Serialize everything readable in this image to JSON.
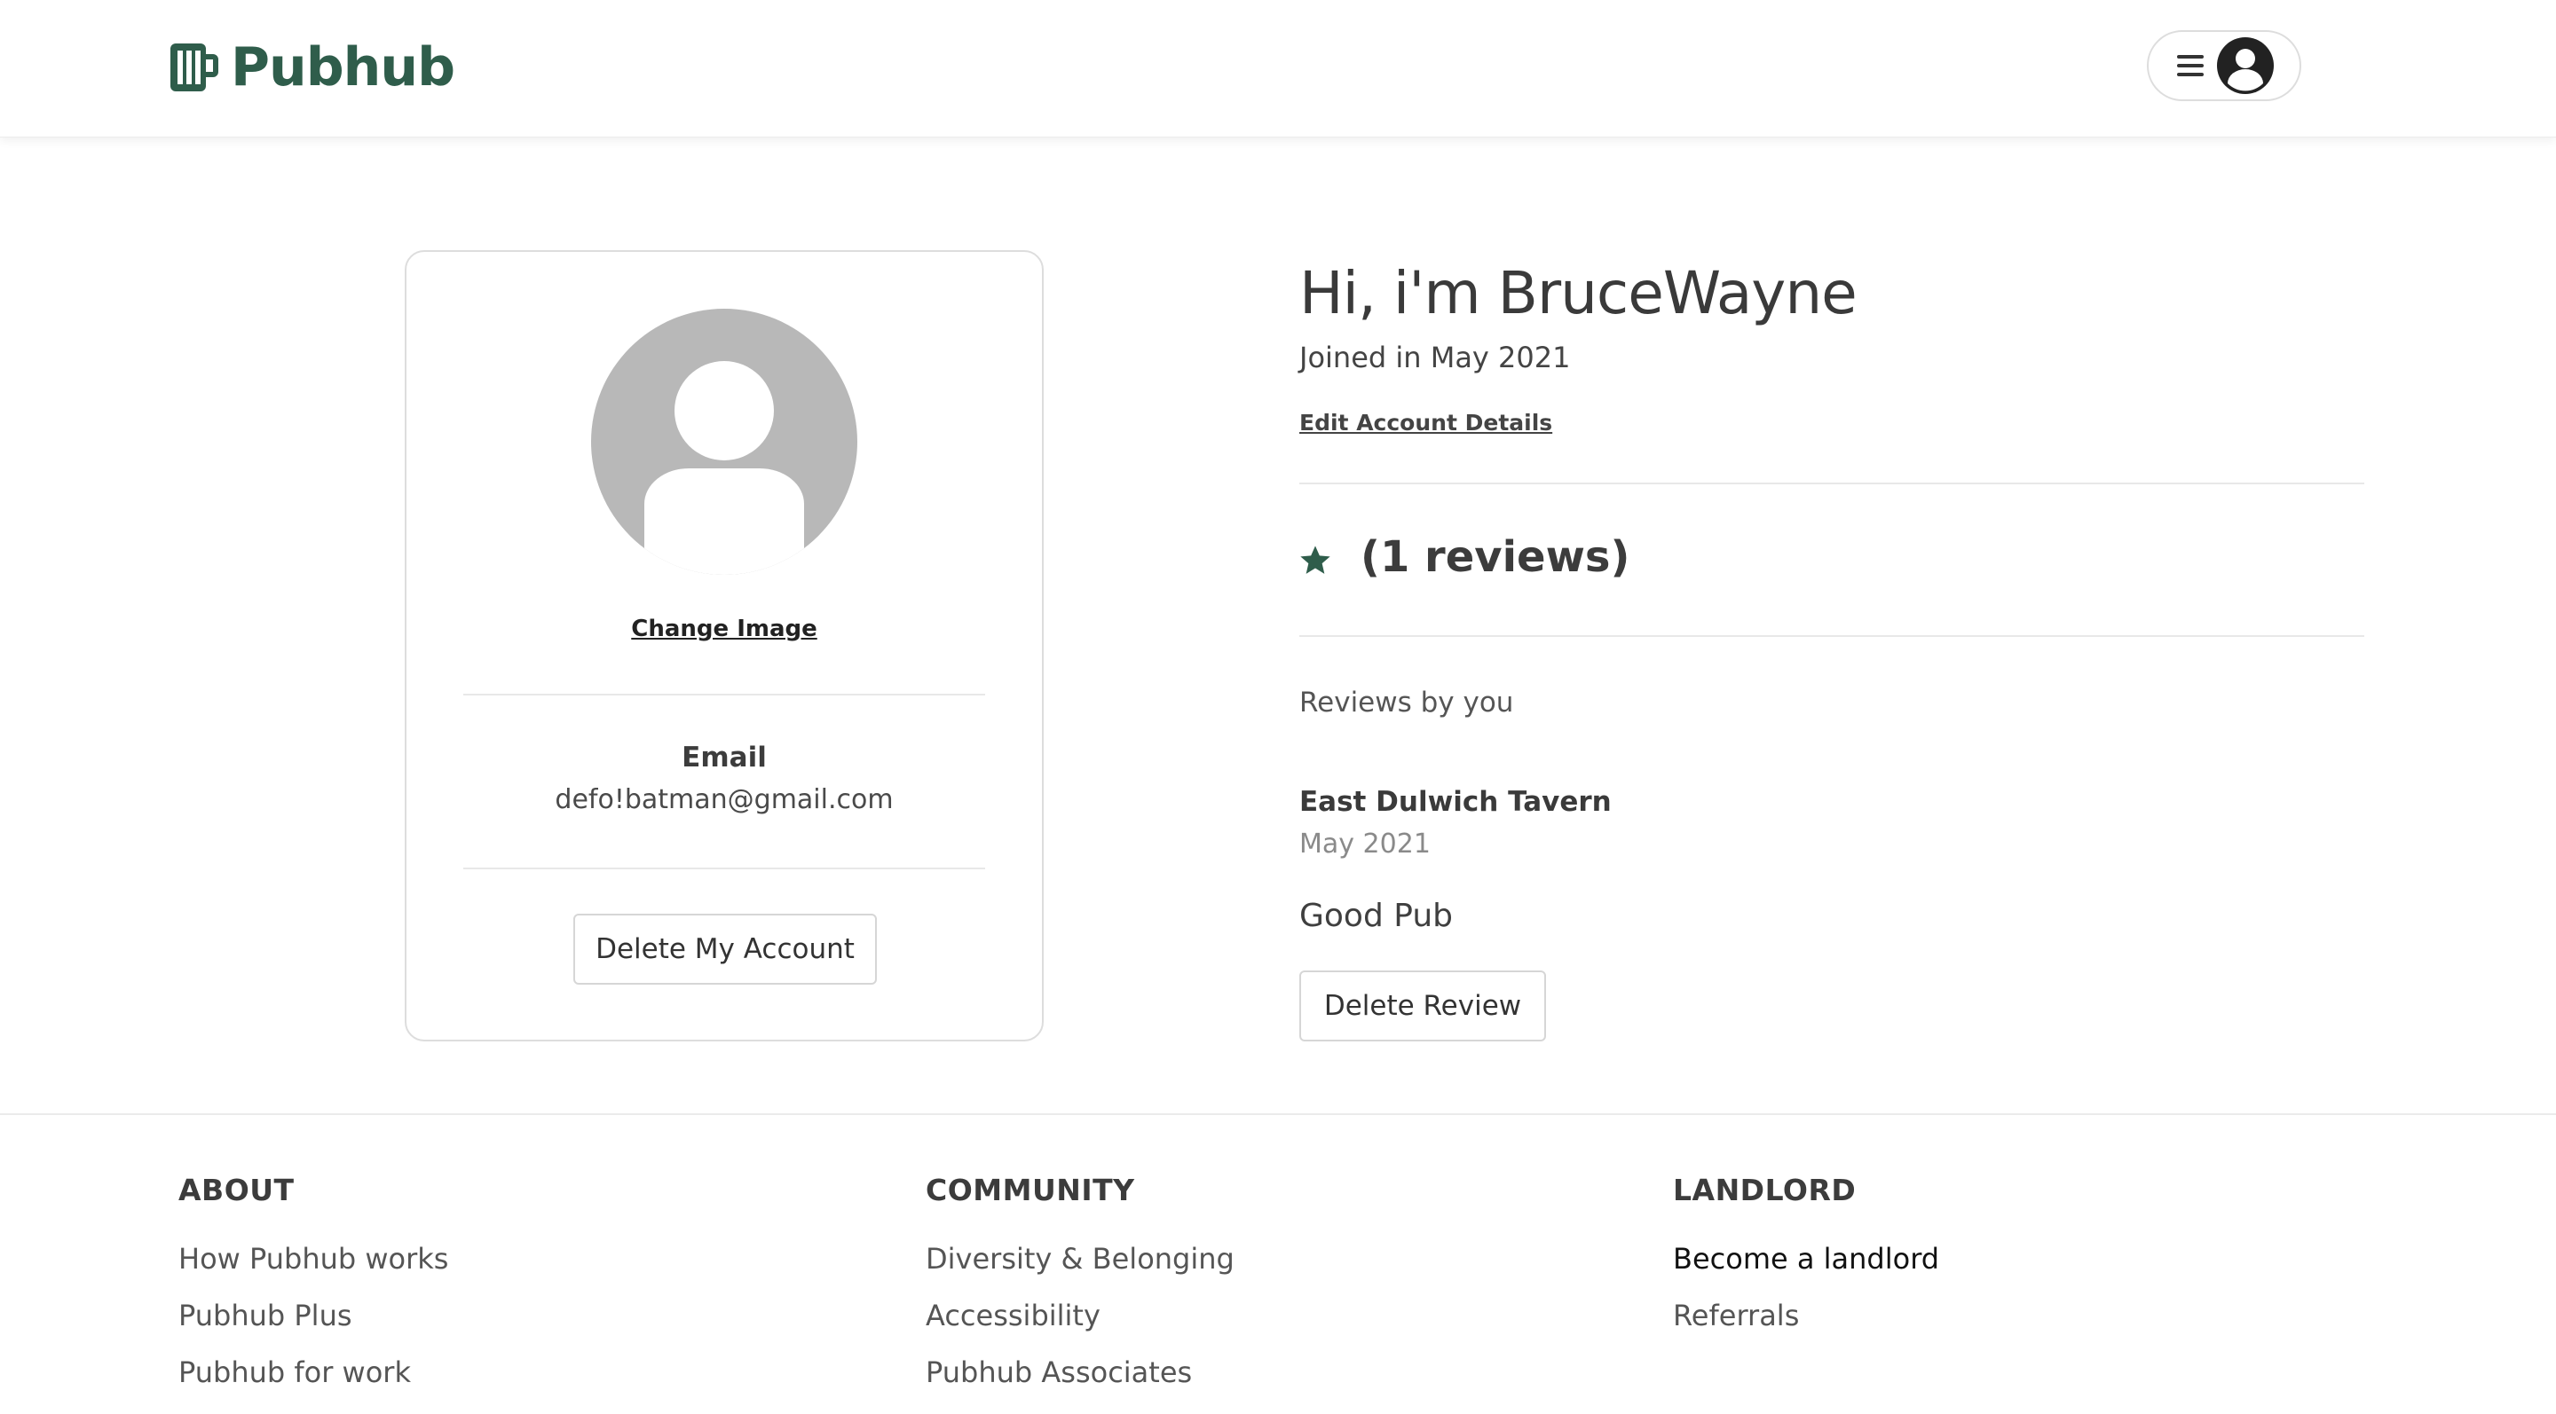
{
  "header": {
    "brand": "Pubhub",
    "icons": {
      "logo": "beer-mug-logo",
      "menu": "hamburger-menu-icon",
      "avatar": "user-avatar-icon"
    }
  },
  "profile_card": {
    "change_image": "Change Image",
    "email_label": "Email",
    "email_value": "defo!batman@gmail.com",
    "delete_account": "Delete My Account",
    "avatar_icon": "default-avatar-icon"
  },
  "profile": {
    "greeting": "Hi, i'm BruceWayne",
    "joined": "Joined in May 2021",
    "edit_link": "Edit Account Details",
    "reviews_count": "(1 reviews)",
    "star_icon": "star-icon",
    "reviews_heading": "Reviews by you"
  },
  "reviews": [
    {
      "pub": "East Dulwich Tavern",
      "date": "May 2021",
      "text": "Good Pub",
      "delete": "Delete Review"
    }
  ],
  "footer": {
    "columns": [
      {
        "title": "ABOUT",
        "links": [
          "How Pubhub works",
          "Pubhub Plus",
          "Pubhub for work"
        ]
      },
      {
        "title": "COMMUNITY",
        "links": [
          "Diversity & Belonging",
          "Accessibility",
          "Pubhub Associates"
        ]
      },
      {
        "title": "LANDLORD",
        "links": [
          "Become a landlord",
          "Referrals"
        ]
      }
    ]
  },
  "colors": {
    "brand": "#2f5d4b",
    "text": "#3f3f3f",
    "avatar_grey": "#b8b8b8",
    "border": "#dddddd"
  }
}
